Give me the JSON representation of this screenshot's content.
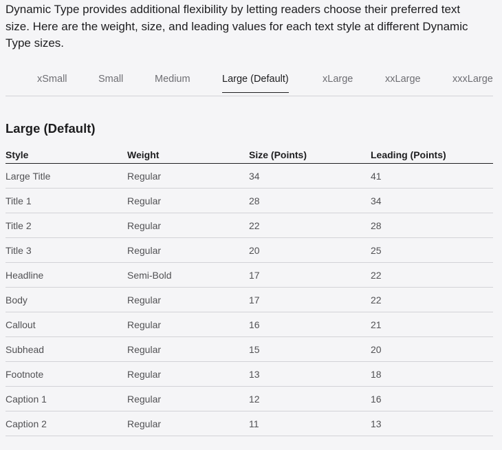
{
  "intro": "Dynamic Type provides additional flexibility by letting readers choose their preferred text size. Here are the weight, size, and leading values for each text style at different Dynamic Type sizes.",
  "tabs": [
    "xSmall",
    "Small",
    "Medium",
    "Large (Default)",
    "xLarge",
    "xxLarge",
    "xxxLarge"
  ],
  "active_tab": "Large (Default)",
  "section_title": "Large (Default)",
  "table": {
    "headers": [
      "Style",
      "Weight",
      "Size (Points)",
      "Leading (Points)"
    ],
    "rows": [
      [
        "Large Title",
        "Regular",
        "34",
        "41"
      ],
      [
        "Title 1",
        "Regular",
        "28",
        "34"
      ],
      [
        "Title 2",
        "Regular",
        "22",
        "28"
      ],
      [
        "Title 3",
        "Regular",
        "20",
        "25"
      ],
      [
        "Headline",
        "Semi-Bold",
        "17",
        "22"
      ],
      [
        "Body",
        "Regular",
        "17",
        "22"
      ],
      [
        "Callout",
        "Regular",
        "16",
        "21"
      ],
      [
        "Subhead",
        "Regular",
        "15",
        "20"
      ],
      [
        "Footnote",
        "Regular",
        "13",
        "18"
      ],
      [
        "Caption 1",
        "Regular",
        "12",
        "16"
      ],
      [
        "Caption 2",
        "Regular",
        "11",
        "13"
      ]
    ]
  }
}
